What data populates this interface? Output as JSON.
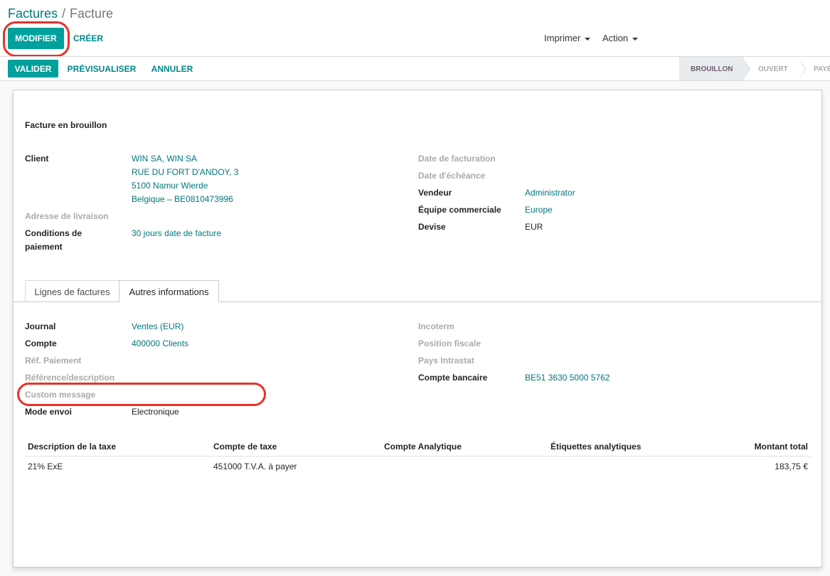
{
  "breadcrumb": {
    "parent": "Factures",
    "separator": "/",
    "current": "Facture"
  },
  "control": {
    "edit": "MODIFIER",
    "create": "CRÉER",
    "print": "Imprimer",
    "action": "Action"
  },
  "header_buttons": {
    "validate": "VALIDER",
    "preview": "PRÉVISUALISER",
    "cancel": "ANNULER"
  },
  "status": {
    "stages": [
      "BROUILLON",
      "OUVERT",
      "PAYÉ"
    ],
    "active": "BROUILLON"
  },
  "sheet": {
    "title": "Facture en brouillon",
    "client_label": "Client",
    "client_lines": [
      "WIN SA, WIN SA",
      "RUE DU FORT D'ANDOY, 3",
      "5100 Namur Wierde",
      "Belgique – BE0810473996"
    ],
    "delivery_label": "Adresse de livraison",
    "terms_label_1": "Conditions de",
    "terms_label_2": "paiement",
    "terms_value": "30 jours date de facture",
    "invoice_date_label": "Date de facturation",
    "due_date_label": "Date d'échéance",
    "salesperson_label": "Vendeur",
    "salesperson_value": "Administrator",
    "team_label": "Équipe commerciale",
    "team_value": "Europe",
    "currency_label": "Devise",
    "currency_value": "EUR"
  },
  "tabs": {
    "lines": "Lignes de factures",
    "other": "Autres informations"
  },
  "other_info": {
    "journal_label": "Journal",
    "journal_value": "Ventes (EUR)",
    "account_label": "Compte",
    "account_value": "400000 Clients",
    "payment_ref_label": "Réf. Paiement",
    "reference_label": "Référence/description",
    "custom_message_label": "Custom message",
    "send_mode_label": "Mode envoi",
    "send_mode_value": "Electronique",
    "incoterm_label": "Incoterm",
    "fiscal_position_label": "Position fiscale",
    "intrastat_label": "Pays Intrastat",
    "bank_account_label": "Compte bancaire",
    "bank_account_value": "BE51 3630 5000 5762"
  },
  "tax_table": {
    "headers": [
      "Description de la taxe",
      "Compte de taxe",
      "Compte Analytique",
      "Étiquettes analytiques",
      "Montant total"
    ],
    "rows": [
      [
        "21% ExE",
        "451000 T.V.A. à payer",
        "",
        "",
        "183,75 €"
      ]
    ]
  },
  "colors": {
    "primary": "#00A09D",
    "link": "#00777e",
    "annotation": "#e8312a"
  }
}
